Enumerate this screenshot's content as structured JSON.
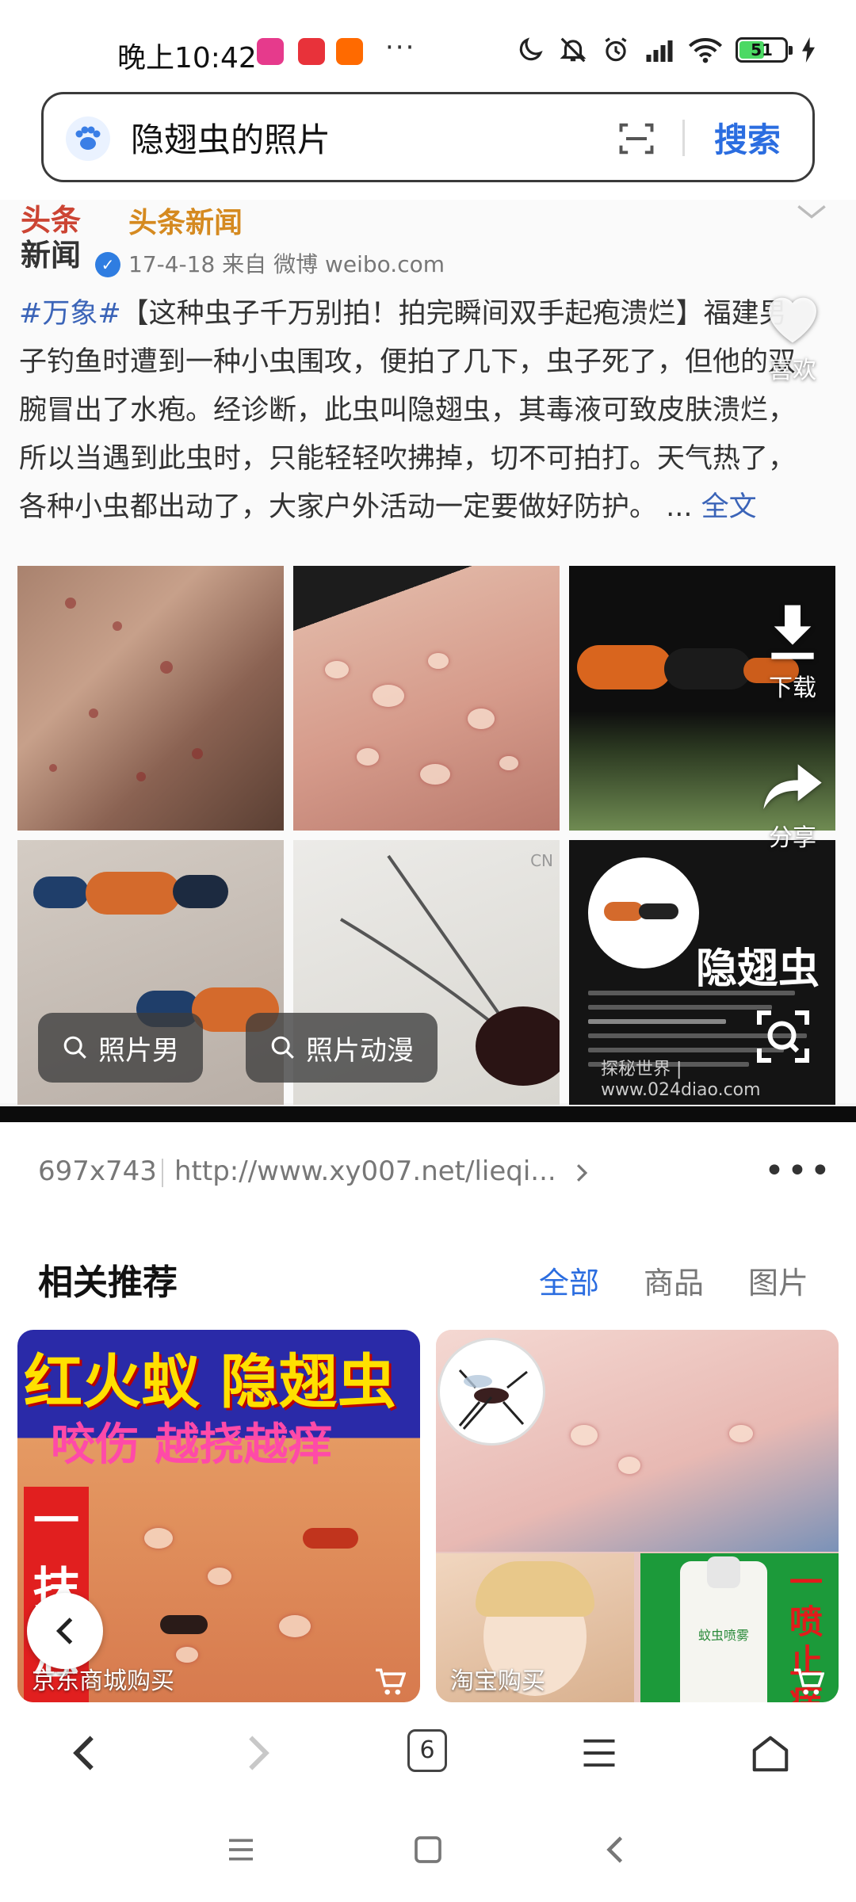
{
  "status_bar": {
    "time": "晚上10:42",
    "overflow": "···",
    "battery": "51",
    "battery_level_percent": 51,
    "icons": [
      "moon-icon",
      "bell-off-icon",
      "alarm-icon",
      "signal-icon",
      "wifi-icon",
      "battery-icon",
      "charging-icon"
    ]
  },
  "search": {
    "query": "隐翅虫的照片",
    "button_label": "搜索",
    "icons": [
      "paw-icon",
      "scan-icon"
    ]
  },
  "post": {
    "source_name": "头条新闻",
    "avatar_text_1": "头条",
    "avatar_text_2": "新闻",
    "meta": "17-4-18  来自 微博 weibo.com",
    "hashtag": "#万象#",
    "body": "【这种虫子千万别拍！拍完瞬间双手起疱溃烂】福建男子钓鱼时遭到一种小虫围攻，便拍了几下，虫子死了，但他的双腕冒出了水疱。经诊断，此虫叫隐翅虫，其毒液可致皮肤溃烂，所以当遇到此虫时，只能轻轻吹拂掉，切不可拍打。天气热了，各种小虫都出动了，大家户外活动一定要做好防护。",
    "ellipsis": " ... ",
    "more_link": "全文",
    "grid_caption_title": "隐翅虫",
    "grid_caption_footer": "探秘世界 | www.024diao.com",
    "grid_watermark": "CN"
  },
  "side_actions": {
    "like": "喜欢",
    "download": "下载",
    "share": "分享"
  },
  "chips": [
    "照片男",
    "照片动漫"
  ],
  "image_info": {
    "size": "697x743",
    "url": "http://www.xy007.net/lieqi...",
    "more": "•••"
  },
  "related": {
    "title": "相关推荐",
    "tabs": [
      {
        "label": "全部",
        "active": true
      },
      {
        "label": "商品",
        "active": false
      },
      {
        "label": "图片",
        "active": false
      }
    ],
    "cards": [
      {
        "headline_1": "红火蚁 隐翅虫",
        "headline_2": "咬伤 越挠越痒",
        "side_text": "一抹忠",
        "label": "京东商城购买"
      },
      {
        "side_text": "一喷止痒",
        "bottle_text": "蚊虫喷雾",
        "label": "淘宝购买"
      }
    ]
  },
  "browser_nav": {
    "tab_count": "6",
    "icons": [
      "back-icon",
      "forward-icon",
      "tabs-icon",
      "menu-icon",
      "home-icon"
    ]
  },
  "colors": {
    "accent": "#2b6de0",
    "link": "#3b64b8",
    "source_name": "#d58a20"
  }
}
